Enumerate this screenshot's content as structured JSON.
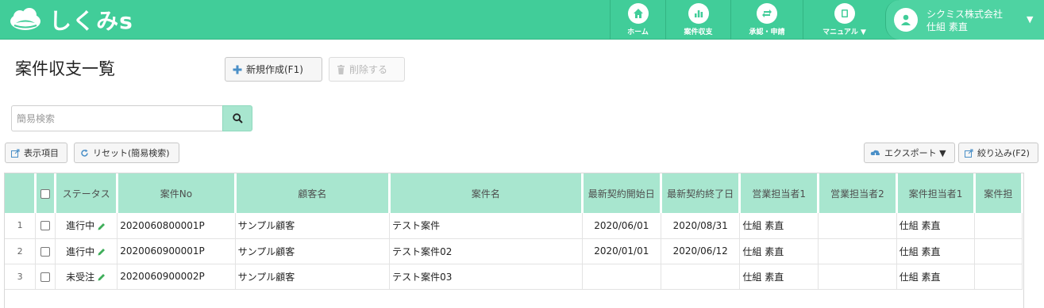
{
  "app": {
    "logo_text": "しくみs",
    "nav": [
      {
        "label": "ホーム",
        "icon": "home-icon"
      },
      {
        "label": "案件収支",
        "icon": "bar-chart-icon"
      },
      {
        "label": "承認・申請",
        "icon": "repeat-icon"
      },
      {
        "label": "マニュアル ▼",
        "icon": "book-icon"
      }
    ],
    "user": {
      "company": "シクミス株式会社",
      "name": "仕組 素直"
    }
  },
  "page": {
    "title": "案件収支一覧",
    "new_button": "新規作成(F1)",
    "delete_button": "削除する",
    "search_placeholder": "簡易検索",
    "display_items_button": "表示項目",
    "reset_button": "リセット(簡易検索)",
    "export_button": "エクスポート ▼",
    "filter_button": "絞り込み(F2)"
  },
  "table": {
    "columns": [
      "ステータス",
      "案件No",
      "顧客名",
      "案件名",
      "最新契約開始日",
      "最新契約終了日",
      "営業担当者1",
      "営業担当者2",
      "案件担当者1",
      "案件担"
    ],
    "rows": [
      {
        "num": "1",
        "status": "進行中",
        "case_no": "2020060800001P",
        "customer": "サンプル顧客",
        "case_name": "テスト案件",
        "start": "2020/06/01",
        "end": "2020/08/31",
        "sales1": "仕組 素直",
        "sales2": "",
        "owner1": "仕組 素直"
      },
      {
        "num": "2",
        "status": "進行中",
        "case_no": "2020060900001P",
        "customer": "サンプル顧客",
        "case_name": "テスト案件02",
        "start": "2020/01/01",
        "end": "2020/06/12",
        "sales1": "仕組 素直",
        "sales2": "",
        "owner1": "仕組 素直"
      },
      {
        "num": "3",
        "status": "未受注",
        "case_no": "2020060900002P",
        "customer": "サンプル顧客",
        "case_name": "テスト案件03",
        "start": "",
        "end": "",
        "sales1": "仕組 素直",
        "sales2": "",
        "owner1": "仕組 素直"
      }
    ]
  }
}
